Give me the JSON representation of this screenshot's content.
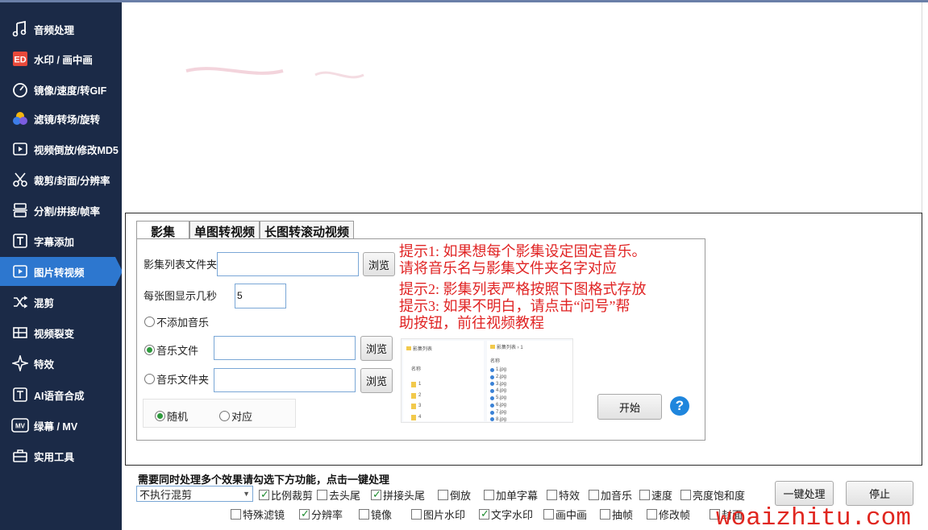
{
  "sidebar": {
    "items": [
      {
        "label": "音频处理",
        "icon": "music-note-icon"
      },
      {
        "label": "水印 / 画中画",
        "icon": "watermark-icon"
      },
      {
        "label": "镜像/速度/转GIF",
        "icon": "speedometer-icon"
      },
      {
        "label": "滤镜/转场/旋转",
        "icon": "color-filter-icon"
      },
      {
        "label": "视频倒放/修改MD5",
        "icon": "video-reverse-icon"
      },
      {
        "label": "裁剪/封面/分辨率",
        "icon": "scissors-icon"
      },
      {
        "label": "分割/拼接/帧率",
        "icon": "split-icon"
      },
      {
        "label": "字幕添加",
        "icon": "subtitle-icon"
      },
      {
        "label": "图片转视频",
        "icon": "image-to-video-icon",
        "active": true
      },
      {
        "label": "混剪",
        "icon": "shuffle-icon"
      },
      {
        "label": "视频裂变",
        "icon": "grid-split-icon"
      },
      {
        "label": "特效",
        "icon": "sparkle-icon"
      },
      {
        "label": "AI语音合成",
        "icon": "ai-voice-icon"
      },
      {
        "label": "绿幕 / MV",
        "icon": "mv-icon"
      },
      {
        "label": "实用工具",
        "icon": "toolbox-icon"
      }
    ]
  },
  "tabs": [
    "影集",
    "单图转视频",
    "长图转滚动视频"
  ],
  "form": {
    "album_folder_label": "影集列表文件夹",
    "album_folder_value": "",
    "browse": "浏览",
    "seconds_label": "每张图显示几秒",
    "seconds_value": "5",
    "no_music": "不添加音乐",
    "music_file": "音乐文件",
    "music_file_value": "",
    "music_folder": "音乐文件夹",
    "music_folder_value": "",
    "random": "随机",
    "match": "对应",
    "start": "开始"
  },
  "hints": {
    "line1": "提示1:   如果想每个影集设定固定音乐。",
    "line2": "请将音乐名与影集文件夹名字对应",
    "line3": "提示2:   影集列表严格按照下图格式存放",
    "line4": "提示3: 如果不明白，请点击“问号”帮",
    "line5": "助按钮，前往视频教程"
  },
  "explorer": {
    "left_path": "影集列表",
    "left_header": "名称",
    "left_items": [
      "1",
      "2",
      "3",
      "4"
    ],
    "right_path": "影集列表 › 1",
    "right_header": "名称",
    "right_items": [
      "1.jpg",
      "2.jpg",
      "3.jpg",
      "4.jpg",
      "5.jpg",
      "6.jpg",
      "7.jpg",
      "8.jpg"
    ]
  },
  "bottom": {
    "title": "需要同时处理多个效果请勾选下方功能，点击一键处理",
    "mode": "不执行混剪",
    "row1": [
      {
        "label": "比例裁剪",
        "checked": true
      },
      {
        "label": "去头尾",
        "checked": false
      },
      {
        "label": "拼接头尾",
        "checked": true
      },
      {
        "label": "倒放",
        "checked": false
      },
      {
        "label": "加单字幕",
        "checked": false
      },
      {
        "label": "特效",
        "checked": false
      },
      {
        "label": "加音乐",
        "checked": false
      },
      {
        "label": "速度",
        "checked": false
      },
      {
        "label": "亮度饱和度",
        "checked": false
      }
    ],
    "row2": [
      {
        "label": "特殊滤镜",
        "checked": false
      },
      {
        "label": "分辨率",
        "checked": true
      },
      {
        "label": "镜像",
        "checked": false
      },
      {
        "label": "图片水印",
        "checked": false
      },
      {
        "label": "文字水印",
        "checked": true
      },
      {
        "label": "画中画",
        "checked": false
      },
      {
        "label": "抽帧",
        "checked": false
      },
      {
        "label": "修改帧",
        "checked": false
      },
      {
        "label": "封面",
        "checked": false
      }
    ],
    "process": "一键处理",
    "stop": "停止"
  },
  "watermark": "woaizhitu.com",
  "colors": {
    "sidebar_bg": "#1b2a47",
    "sidebar_active": "#2d77cf",
    "hint_red": "#e02424",
    "help_blue": "#1f86dd"
  }
}
